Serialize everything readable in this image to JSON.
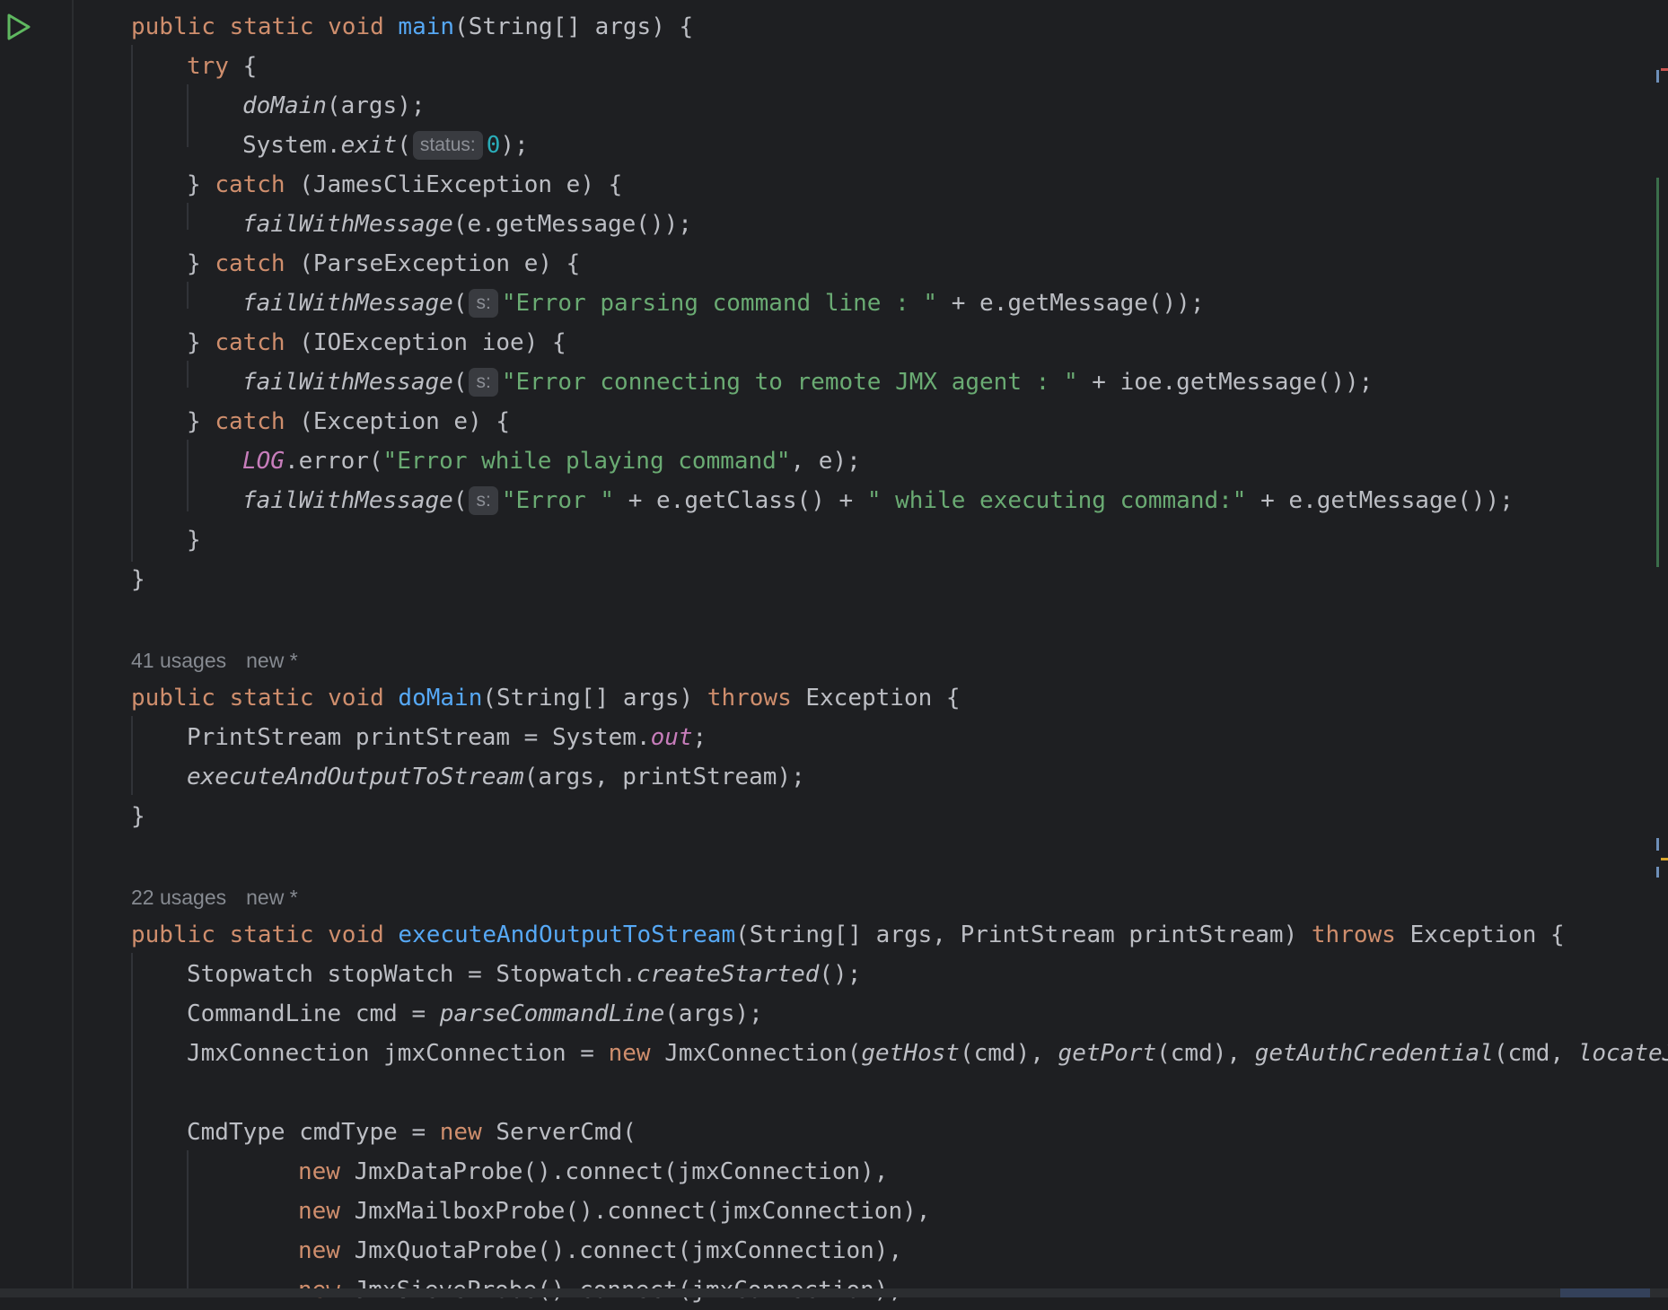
{
  "hint_labels": {
    "status": "status:",
    "s": "s:"
  },
  "usages": {
    "domain": {
      "count": "41 usages",
      "tag": "new *"
    },
    "execute": {
      "count": "22 usages",
      "tag": "new *"
    }
  },
  "code": {
    "l1": {
      "a": "public static void ",
      "b": "main",
      "c": "(String[] args) {"
    },
    "l2": {
      "a": "try",
      "b": " {"
    },
    "l3": {
      "a": "doMain",
      "b": "(args);"
    },
    "l4": {
      "a": "System.",
      "b": "exit",
      "c": "(",
      "d": "0",
      "e": ");"
    },
    "l5": {
      "a": "} ",
      "b": "catch",
      "c": " (JamesCliException e) {"
    },
    "l6": {
      "a": "failWithMessage",
      "b": "(e.getMessage());"
    },
    "l7": {
      "a": "} ",
      "b": "catch",
      "c": " (ParseException e) {"
    },
    "l8": {
      "a": "failWithMessage",
      "b": "(",
      "c": "\"Error parsing command line : \"",
      "d": " + e.getMessage());"
    },
    "l9": {
      "a": "} ",
      "b": "catch",
      "c": " (IOException ioe) {"
    },
    "l10": {
      "a": "failWithMessage",
      "b": "(",
      "c": "\"Error connecting to remote JMX agent : \"",
      "d": " + ioe.getMessage());"
    },
    "l11": {
      "a": "} ",
      "b": "catch",
      "c": " (Exception e) {"
    },
    "l12": {
      "a": "LOG",
      "b": ".error(",
      "c": "\"Error while playing command\"",
      "d": ", e);"
    },
    "l13": {
      "a": "failWithMessage",
      "b": "(",
      "c": "\"Error \"",
      "d": " + e.getClass() + ",
      "e": "\" while executing command:\"",
      "f": " + e.getMessage());"
    },
    "l14": {
      "a": "}"
    },
    "l15": {
      "a": "}"
    },
    "l16": {
      "a": "public static void ",
      "b": "doMain",
      "c": "(String[] args) ",
      "d": "throws",
      "e": " Exception {"
    },
    "l17": {
      "a": "PrintStream printStream = System.",
      "b": "out",
      "c": ";"
    },
    "l18": {
      "a": "executeAndOutputToStream",
      "b": "(args, printStream);"
    },
    "l19": {
      "a": "}"
    },
    "l20": {
      "a": "public static void ",
      "b": "executeAndOutputToStream",
      "c": "(String[] args, PrintStream printStream) ",
      "d": "throws",
      "e": " Exception {"
    },
    "l21": {
      "a": "Stopwatch stopWatch = Stopwatch.",
      "b": "createStarted",
      "c": "();"
    },
    "l22": {
      "a": "CommandLine cmd = ",
      "b": "parseCommandLine",
      "c": "(args);"
    },
    "l23": {
      "a": "JmxConnection jmxConnection = ",
      "b": "new",
      "c": " JmxConnection(",
      "d": "getHost",
      "e": "(cmd), ",
      "f": "getPort",
      "g": "(cmd), ",
      "h": "getAuthCredential",
      "i": "(cmd, ",
      "j": "locateJ"
    },
    "l24": {
      "a": "CmdType cmdType = ",
      "b": "new",
      "c": " ServerCmd("
    },
    "l25": {
      "a": "new",
      "b": " JmxDataProbe().connect(jmxConnection),"
    },
    "l26": {
      "a": "new",
      "b": " JmxMailboxProbe().connect(jmxConnection),"
    },
    "l27": {
      "a": "new",
      "b": " JmxQuotaProbe().connect(jmxConnection),"
    },
    "l28": {
      "a": "new",
      "b": " JmxSieveProbe().connect(jmxConnection),"
    }
  },
  "colors": {
    "background": "#1e1f22",
    "keyword": "#cf8e6d",
    "method_decl": "#56a8f5",
    "string": "#6aab73",
    "number": "#2aacb8",
    "static_field": "#c77dbb",
    "text": "#bcbec4"
  },
  "icons": {
    "run": "run-play-icon"
  }
}
